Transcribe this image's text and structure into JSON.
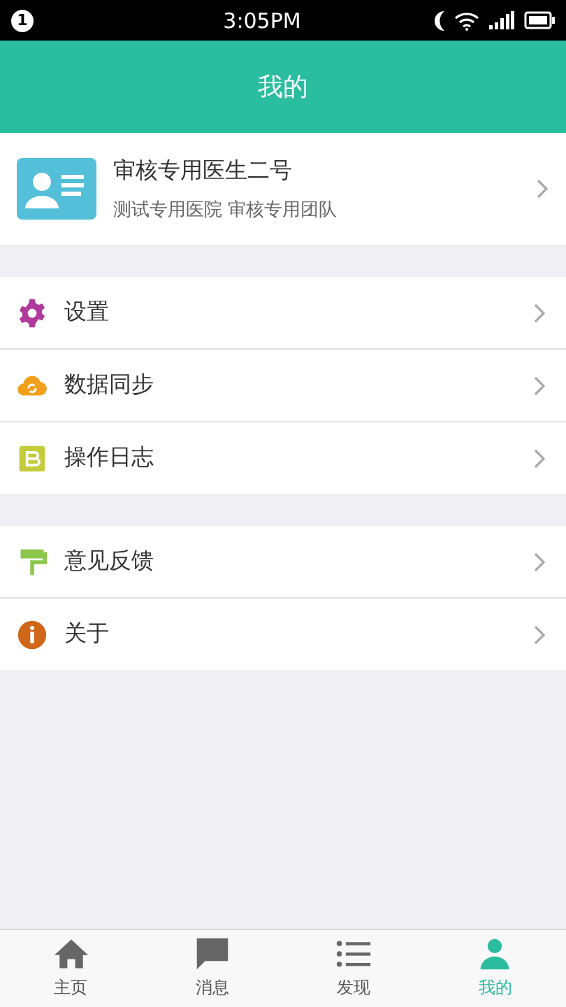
{
  "status_bar": {
    "notification_count": "1",
    "time": "3:05PM"
  },
  "header": {
    "title": "我的"
  },
  "profile": {
    "name": "审核专用医生二号",
    "subtitle": "测试专用医院 审核专用团队"
  },
  "menu_groups": [
    {
      "items": [
        {
          "label": "设置"
        },
        {
          "label": "数据同步"
        },
        {
          "label": "操作日志"
        }
      ]
    },
    {
      "items": [
        {
          "label": "意见反馈"
        },
        {
          "label": "关于"
        }
      ]
    }
  ],
  "tabs": [
    {
      "label": "主页",
      "selected": false
    },
    {
      "label": "消息",
      "selected": false
    },
    {
      "label": "发现",
      "selected": false
    },
    {
      "label": "我的",
      "selected": true
    }
  ]
}
